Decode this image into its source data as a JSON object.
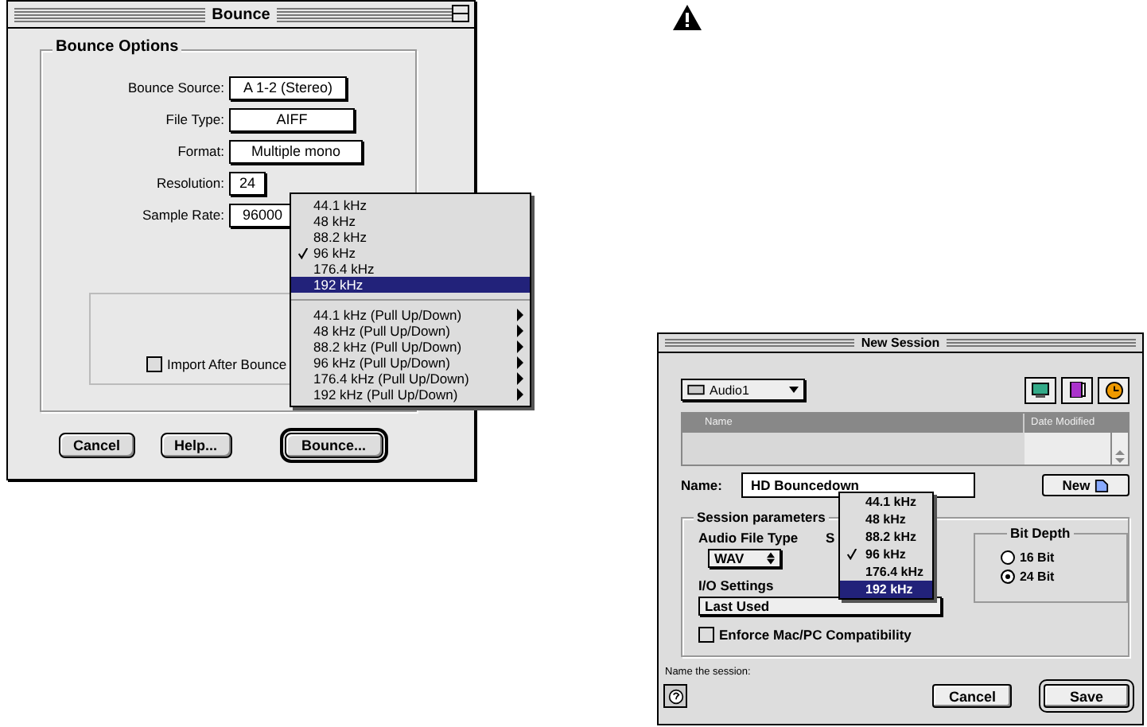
{
  "bounce_window": {
    "title": "Bounce",
    "group_title": "Bounce Options",
    "fields": [
      {
        "label": "Bounce Source:",
        "value": "A 1-2 (Stereo)"
      },
      {
        "label": "File Type:",
        "value": "AIFF"
      },
      {
        "label": "Format:",
        "value": "Multiple mono"
      },
      {
        "label": "Resolution:",
        "value": "24"
      },
      {
        "label": "Sample Rate:",
        "value": "96000"
      }
    ],
    "import_checkbox": {
      "label": "Import After Bounce",
      "checked": false
    },
    "buttons": [
      {
        "label": "Cancel",
        "default": false
      },
      {
        "label": "Help...",
        "default": false
      },
      {
        "label": "Bounce...",
        "default": true
      }
    ],
    "sample_rate_menu": [
      {
        "kind": "item",
        "label": "44.1 kHz",
        "checked": false,
        "selected": false
      },
      {
        "kind": "item",
        "label": "48 kHz",
        "checked": false,
        "selected": false
      },
      {
        "kind": "item",
        "label": "88.2 kHz",
        "checked": false,
        "selected": false
      },
      {
        "kind": "item",
        "label": "96 kHz",
        "checked": true,
        "selected": false
      },
      {
        "kind": "item",
        "label": "176.4 kHz",
        "checked": false,
        "selected": false
      },
      {
        "kind": "item",
        "label": "192 kHz",
        "checked": false,
        "selected": true
      },
      {
        "kind": "separator"
      },
      {
        "kind": "submenu",
        "label": "44.1 kHz (Pull Up/Down)",
        "checked": false,
        "selected": false
      },
      {
        "kind": "submenu",
        "label": "48 kHz (Pull Up/Down)",
        "checked": false,
        "selected": false
      },
      {
        "kind": "submenu",
        "label": "88.2 kHz (Pull Up/Down)",
        "checked": false,
        "selected": false
      },
      {
        "kind": "submenu",
        "label": "96 kHz (Pull Up/Down)",
        "checked": false,
        "selected": false
      },
      {
        "kind": "submenu",
        "label": "176.4 kHz (Pull Up/Down)",
        "checked": false,
        "selected": false
      },
      {
        "kind": "submenu",
        "label": "192 kHz (Pull Up/Down)",
        "checked": false,
        "selected": false
      }
    ]
  },
  "new_session_window": {
    "title": "New Session",
    "folder": "Audio1",
    "columns": [
      "Name",
      "Date Modified"
    ],
    "name_label": "Name:",
    "name_value": "HD Bouncedown",
    "new_button": "New",
    "group_title": "Session parameters",
    "audio_file_type_label": "Audio File Type",
    "audio_file_type": "WAV",
    "sample_rate_label": "S",
    "io_label": "I/O Settings",
    "io_value": "Last Used",
    "bit_depth": {
      "title": "Bit Depth",
      "options": [
        {
          "label": "16 Bit",
          "selected": false
        },
        {
          "label": "24 Bit",
          "selected": true
        }
      ]
    },
    "enforce_checkbox": {
      "label": "Enforce Mac/PC Compatibility",
      "checked": false
    },
    "status": "Name the session:",
    "buttons": [
      {
        "label": "Cancel",
        "default": false
      },
      {
        "label": "Save",
        "default": true
      }
    ],
    "sample_rate_menu": [
      {
        "label": "44.1 kHz",
        "checked": false,
        "selected": false
      },
      {
        "label": "48 kHz",
        "checked": false,
        "selected": false
      },
      {
        "label": "88.2 kHz",
        "checked": false,
        "selected": false
      },
      {
        "label": "96 kHz",
        "checked": true,
        "selected": false
      },
      {
        "label": "176.4 kHz",
        "checked": false,
        "selected": false
      },
      {
        "label": "192 kHz",
        "checked": false,
        "selected": true
      }
    ]
  }
}
